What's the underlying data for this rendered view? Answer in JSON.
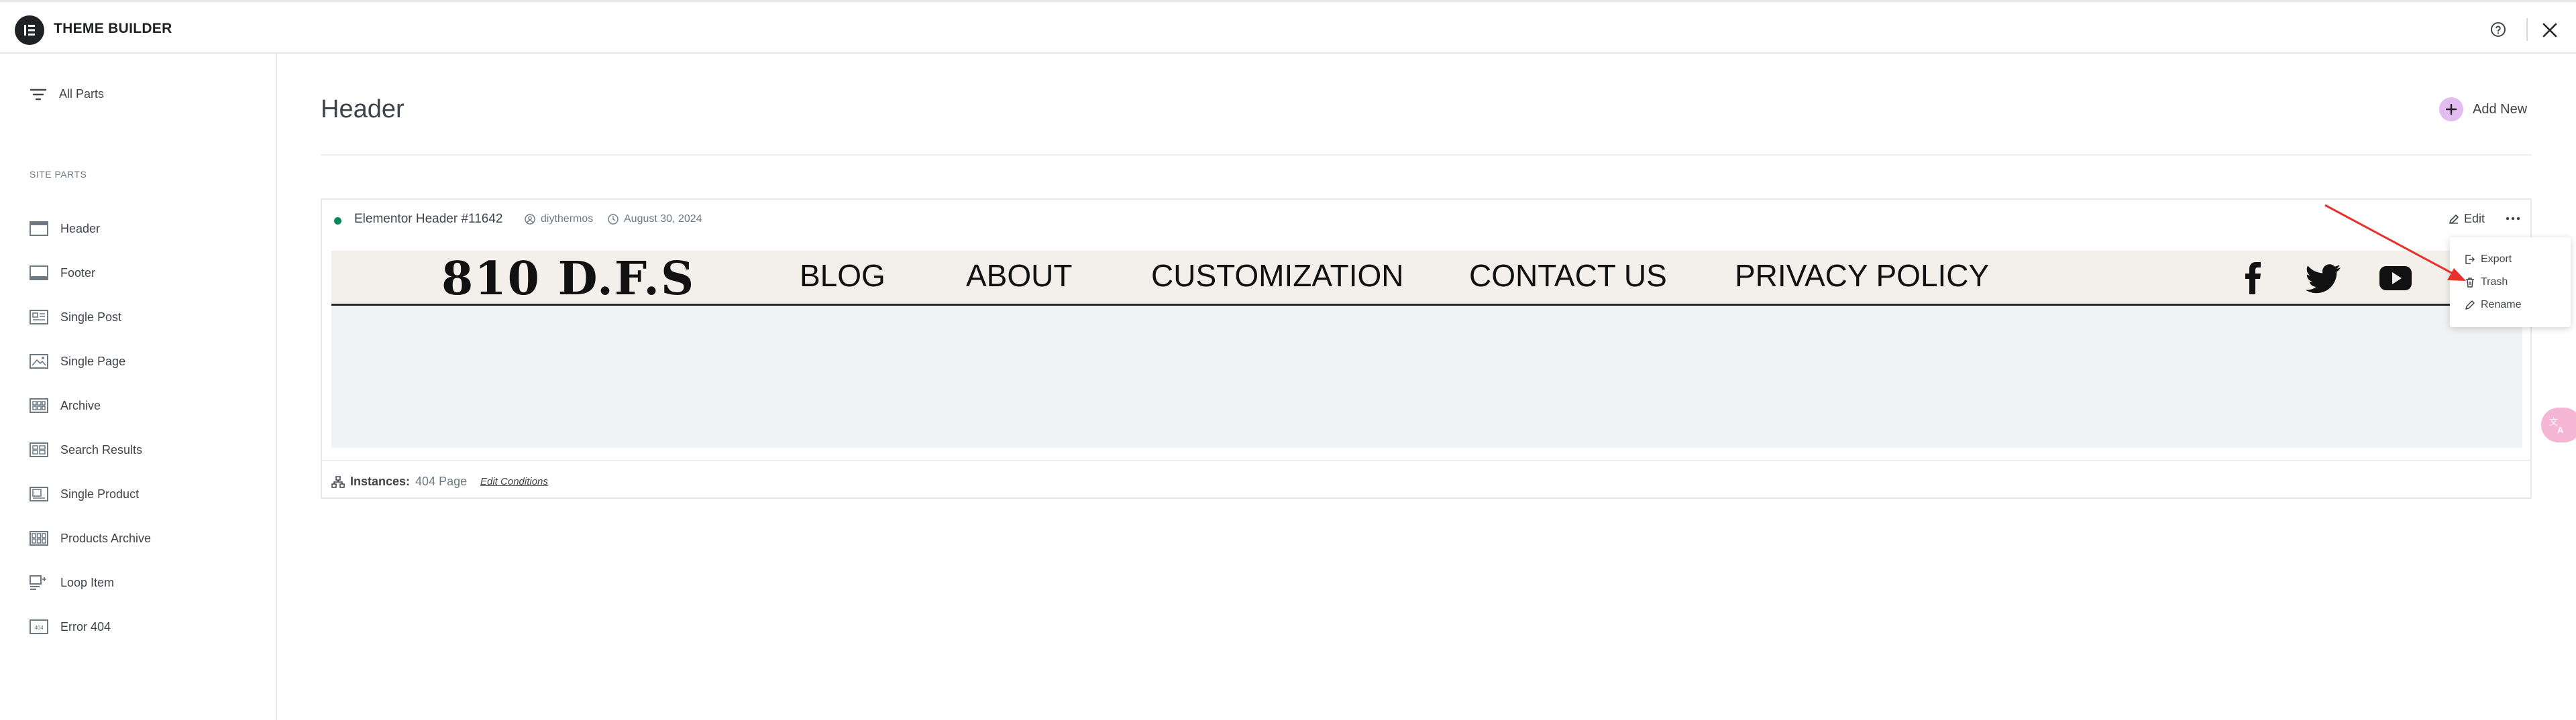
{
  "app": {
    "title": "THEME BUILDER"
  },
  "sidebar": {
    "all_parts": "All Parts",
    "section_title": "SITE PARTS",
    "items": [
      {
        "label": "Header",
        "icon": "header-template-icon"
      },
      {
        "label": "Footer",
        "icon": "footer-template-icon"
      },
      {
        "label": "Single Post",
        "icon": "single-post-icon"
      },
      {
        "label": "Single Page",
        "icon": "single-page-icon"
      },
      {
        "label": "Archive",
        "icon": "archive-icon"
      },
      {
        "label": "Search Results",
        "icon": "search-results-icon"
      },
      {
        "label": "Single Product",
        "icon": "single-product-icon"
      },
      {
        "label": "Products Archive",
        "icon": "products-archive-icon"
      },
      {
        "label": "Loop Item",
        "icon": "loop-item-icon"
      },
      {
        "label": "Error 404",
        "icon": "error-404-icon"
      }
    ]
  },
  "main": {
    "title": "Header",
    "add_new": "Add New",
    "card": {
      "status_color": "#0a875a",
      "title": "Elementor Header #11642",
      "author": "diythermos",
      "date": "August 30, 2024",
      "edit_label": "Edit",
      "preview": {
        "logo": "810 D.F.S",
        "nav": [
          "BLOG",
          "ABOUT",
          "CUSTOMIZATION",
          "CONTACT US",
          "PRIVACY POLICY"
        ],
        "social": [
          "facebook-icon",
          "twitter-icon",
          "youtube-icon"
        ]
      },
      "instances_label": "Instances:",
      "instances_value": "404 Page",
      "edit_conditions": "Edit Conditions"
    },
    "menu": [
      {
        "label": "Export",
        "icon": "export-icon"
      },
      {
        "label": "Trash",
        "icon": "trash-icon"
      },
      {
        "label": "Rename",
        "icon": "rename-icon"
      }
    ]
  },
  "colors": {
    "accent": "#e4bdf0",
    "arrow": "#e8302c",
    "translate_fab": "#f5b6d6"
  }
}
